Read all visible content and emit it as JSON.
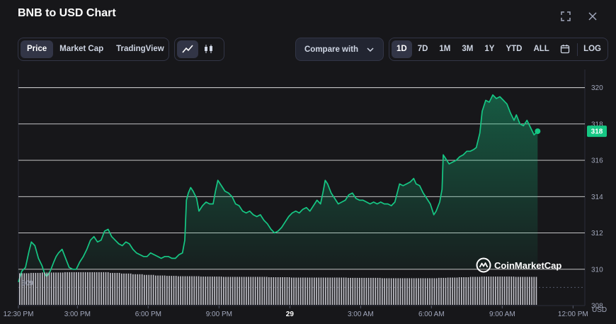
{
  "title": "BNB to USD Chart",
  "tabs": [
    {
      "label": "Price",
      "active": true
    },
    {
      "label": "Market Cap",
      "active": false
    },
    {
      "label": "TradingView",
      "active": false
    }
  ],
  "compare_label": "Compare with",
  "ranges": [
    {
      "label": "1D",
      "active": true
    },
    {
      "label": "7D",
      "active": false
    },
    {
      "label": "1M",
      "active": false
    },
    {
      "label": "3M",
      "active": false
    },
    {
      "label": "1Y",
      "active": false
    },
    {
      "label": "YTD",
      "active": false
    },
    {
      "label": "ALL",
      "active": false
    }
  ],
  "log_label": "LOG",
  "watermark": "CoinMarketCap",
  "colors": {
    "line": "#16c784",
    "accent_bg": "#16c784",
    "panel_bg": "#17171a",
    "gridline": "#ffffff",
    "muted": "#a1a7bb",
    "volume": "#d0d0d8"
  },
  "chart_data": {
    "type": "area",
    "ylim": [
      308,
      321
    ],
    "y_ticks": [
      308,
      310,
      312,
      314,
      316,
      318,
      320
    ],
    "y_tick_labels": [
      "308",
      "310",
      "312",
      "314",
      "316",
      "318",
      "320"
    ],
    "start_price_label": "309",
    "current_price_label": "318",
    "current_price": 317.6,
    "unit_label": "USD",
    "x_ticks": [
      {
        "label": "12:30 PM",
        "hours": 0,
        "bold": false
      },
      {
        "label": "3:00 PM",
        "hours": 2.5,
        "bold": false
      },
      {
        "label": "6:00 PM",
        "hours": 5.5,
        "bold": false
      },
      {
        "label": "9:00 PM",
        "hours": 8.5,
        "bold": false
      },
      {
        "label": "29",
        "hours": 11.5,
        "bold": true
      },
      {
        "label": "3:00 AM",
        "hours": 14.5,
        "bold": false
      },
      {
        "label": "6:00 AM",
        "hours": 17.5,
        "bold": false
      },
      {
        "label": "9:00 AM",
        "hours": 20.5,
        "bold": false
      },
      {
        "label": "12:00 PM",
        "hours": 23.5,
        "bold": false
      }
    ],
    "x_range_hours": [
      0,
      24
    ],
    "series": [
      {
        "points": [
          [
            0.0,
            309.3
          ],
          [
            0.15,
            309.9
          ],
          [
            0.3,
            310.1
          ],
          [
            0.45,
            311.0
          ],
          [
            0.55,
            311.5
          ],
          [
            0.7,
            311.3
          ],
          [
            0.85,
            310.6
          ],
          [
            1.0,
            310.2
          ],
          [
            1.1,
            309.8
          ],
          [
            1.2,
            309.6
          ],
          [
            1.35,
            309.9
          ],
          [
            1.5,
            310.4
          ],
          [
            1.6,
            310.7
          ],
          [
            1.7,
            310.9
          ],
          [
            1.85,
            311.1
          ],
          [
            2.0,
            310.6
          ],
          [
            2.15,
            310.1
          ],
          [
            2.3,
            310.0
          ],
          [
            2.45,
            310.0
          ],
          [
            2.6,
            310.4
          ],
          [
            2.75,
            310.7
          ],
          [
            2.9,
            311.1
          ],
          [
            3.05,
            311.6
          ],
          [
            3.2,
            311.8
          ],
          [
            3.35,
            311.5
          ],
          [
            3.5,
            311.6
          ],
          [
            3.65,
            312.1
          ],
          [
            3.8,
            312.2
          ],
          [
            3.95,
            311.8
          ],
          [
            4.1,
            311.6
          ],
          [
            4.25,
            311.4
          ],
          [
            4.4,
            311.3
          ],
          [
            4.55,
            311.5
          ],
          [
            4.7,
            311.4
          ],
          [
            4.85,
            311.1
          ],
          [
            5.0,
            310.9
          ],
          [
            5.15,
            310.8
          ],
          [
            5.3,
            310.7
          ],
          [
            5.45,
            310.7
          ],
          [
            5.6,
            310.9
          ],
          [
            5.75,
            310.8
          ],
          [
            5.9,
            310.7
          ],
          [
            6.05,
            310.6
          ],
          [
            6.2,
            310.7
          ],
          [
            6.35,
            310.7
          ],
          [
            6.5,
            310.6
          ],
          [
            6.65,
            310.6
          ],
          [
            6.8,
            310.8
          ],
          [
            6.95,
            310.9
          ],
          [
            7.05,
            311.6
          ],
          [
            7.12,
            313.8
          ],
          [
            7.2,
            314.2
          ],
          [
            7.3,
            314.5
          ],
          [
            7.4,
            314.3
          ],
          [
            7.55,
            313.9
          ],
          [
            7.65,
            313.2
          ],
          [
            7.8,
            313.5
          ],
          [
            7.95,
            313.7
          ],
          [
            8.1,
            313.6
          ],
          [
            8.25,
            313.6
          ],
          [
            8.35,
            314.3
          ],
          [
            8.45,
            314.9
          ],
          [
            8.6,
            314.6
          ],
          [
            8.75,
            314.3
          ],
          [
            8.9,
            314.2
          ],
          [
            9.05,
            314.0
          ],
          [
            9.2,
            313.6
          ],
          [
            9.35,
            313.5
          ],
          [
            9.5,
            313.2
          ],
          [
            9.65,
            313.1
          ],
          [
            9.8,
            313.2
          ],
          [
            9.95,
            313.0
          ],
          [
            10.1,
            312.9
          ],
          [
            10.25,
            313.0
          ],
          [
            10.4,
            312.7
          ],
          [
            10.55,
            312.5
          ],
          [
            10.7,
            312.2
          ],
          [
            10.85,
            312.0
          ],
          [
            11.0,
            312.1
          ],
          [
            11.15,
            312.3
          ],
          [
            11.3,
            312.6
          ],
          [
            11.45,
            312.9
          ],
          [
            11.6,
            313.1
          ],
          [
            11.75,
            313.2
          ],
          [
            11.9,
            313.1
          ],
          [
            12.05,
            313.3
          ],
          [
            12.2,
            313.4
          ],
          [
            12.35,
            313.2
          ],
          [
            12.5,
            313.5
          ],
          [
            12.65,
            313.8
          ],
          [
            12.8,
            313.6
          ],
          [
            12.9,
            314.2
          ],
          [
            13.0,
            314.9
          ],
          [
            13.1,
            314.7
          ],
          [
            13.25,
            314.2
          ],
          [
            13.4,
            313.9
          ],
          [
            13.55,
            313.6
          ],
          [
            13.7,
            313.7
          ],
          [
            13.85,
            313.8
          ],
          [
            14.0,
            314.1
          ],
          [
            14.15,
            314.2
          ],
          [
            14.3,
            313.9
          ],
          [
            14.45,
            313.8
          ],
          [
            14.6,
            313.8
          ],
          [
            14.75,
            313.7
          ],
          [
            14.9,
            313.6
          ],
          [
            15.05,
            313.7
          ],
          [
            15.2,
            313.6
          ],
          [
            15.35,
            313.7
          ],
          [
            15.5,
            313.6
          ],
          [
            15.65,
            313.6
          ],
          [
            15.8,
            313.5
          ],
          [
            15.95,
            313.7
          ],
          [
            16.05,
            314.2
          ],
          [
            16.15,
            314.7
          ],
          [
            16.3,
            314.6
          ],
          [
            16.45,
            314.7
          ],
          [
            16.6,
            314.8
          ],
          [
            16.75,
            315.0
          ],
          [
            16.85,
            314.7
          ],
          [
            17.0,
            314.6
          ],
          [
            17.15,
            314.2
          ],
          [
            17.3,
            313.9
          ],
          [
            17.45,
            313.6
          ],
          [
            17.6,
            313.0
          ],
          [
            17.7,
            313.2
          ],
          [
            17.85,
            313.7
          ],
          [
            17.95,
            314.4
          ],
          [
            18.0,
            316.3
          ],
          [
            18.1,
            316.1
          ],
          [
            18.25,
            315.8
          ],
          [
            18.4,
            315.9
          ],
          [
            18.55,
            316.0
          ],
          [
            18.7,
            316.2
          ],
          [
            18.85,
            316.3
          ],
          [
            19.0,
            316.5
          ],
          [
            19.15,
            316.5
          ],
          [
            19.3,
            316.6
          ],
          [
            19.4,
            316.7
          ],
          [
            19.55,
            317.5
          ],
          [
            19.65,
            318.7
          ],
          [
            19.8,
            319.3
          ],
          [
            19.95,
            319.2
          ],
          [
            20.1,
            319.6
          ],
          [
            20.25,
            319.4
          ],
          [
            20.4,
            319.5
          ],
          [
            20.55,
            319.3
          ],
          [
            20.7,
            319.1
          ],
          [
            20.85,
            318.6
          ],
          [
            21.0,
            318.2
          ],
          [
            21.1,
            318.5
          ],
          [
            21.25,
            318.0
          ],
          [
            21.4,
            317.9
          ],
          [
            21.55,
            318.2
          ],
          [
            21.7,
            317.8
          ],
          [
            21.85,
            317.4
          ],
          [
            22.0,
            317.6
          ]
        ]
      }
    ],
    "volume": {
      "levels_relative": [
        0.95,
        0.96,
        0.97,
        0.97,
        0.98,
        0.98,
        0.98,
        0.98,
        0.96,
        0.94,
        0.92,
        0.9,
        0.88,
        0.87,
        0.86,
        0.86,
        0.85,
        0.85,
        0.84,
        0.84,
        0.84,
        0.84,
        0.83,
        0.83,
        0.82,
        0.82,
        0.82,
        0.82,
        0.82,
        0.81,
        0.81,
        0.81,
        0.8,
        0.8,
        0.8,
        0.8,
        0.8,
        0.81,
        0.82,
        0.83,
        0.84,
        0.85,
        0.85,
        0.85,
        0.84,
        0.84
      ]
    }
  }
}
